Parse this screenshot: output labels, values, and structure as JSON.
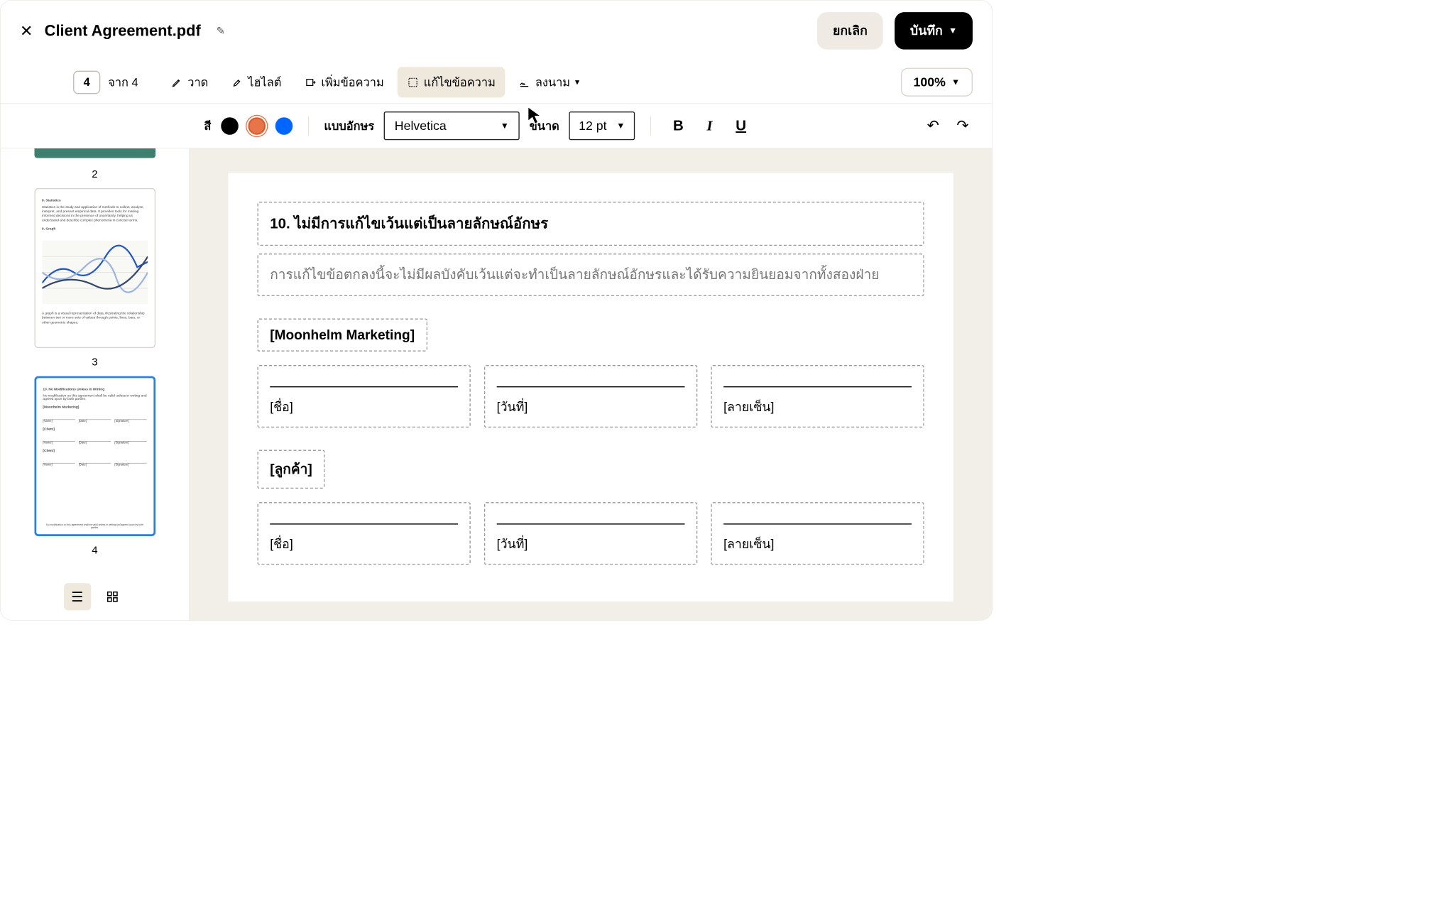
{
  "header": {
    "title": "Client Agreement.pdf",
    "cancel_label": "ยกเลิก",
    "save_label": "บันทึก"
  },
  "toolbar": {
    "page_current": "4",
    "page_total_prefix": "จาก",
    "page_total": "4",
    "draw_label": "วาด",
    "highlight_label": "ไฮไลต์",
    "addtext_label": "เพิ่มข้อความ",
    "edittext_label": "แก้ไขข้อความ",
    "sign_label": "ลงนาม",
    "zoom_label": "100%"
  },
  "subtoolbar": {
    "color_label": "สี",
    "font_label": "แบบอักษร",
    "font_value": "Helvetica",
    "size_label": "ขนาด",
    "size_value": "12 pt"
  },
  "sidebar": {
    "page2_num": "2",
    "page3_num": "3",
    "page4_num": "4",
    "thumb3": {
      "h1": "8. Statistics",
      "p1": "Statistics is the study and application of methods to collect, analyze, interpret, and present empirical data. It provides tools for making informed decisions in the presence of uncertainty, helping us understand and describe complex phenomena in concise terms.",
      "h2": "9. Graph",
      "p2": "A graph is a visual representation of data, illustrating the relationship between two or more sets of values through points, lines, bars, or other geometric shapes."
    },
    "thumb4": {
      "h1": "10. No Modifications Unless In Writing",
      "p1": "No modification on this agreement shall be valid unless in writing and agreed upon by both parties.",
      "company": "[Moonhelm Marketing]",
      "name": "[Name]",
      "date": "[Date]",
      "signature": "[Signature]",
      "client": "[Client]"
    }
  },
  "document": {
    "section_heading": "10. ไม่มีการแก้ไขเว้นแต่เป็นลายลักษณ์อักษร",
    "section_body": "การแก้ไขข้อตกลงนี้จะไม่มีผลบังคับเว้นแต่จะทำเป็นลายลักษณ์อักษรและได้รับความยินยอมจากทั้งสองฝ่าย",
    "party1": "[Moonhelm Marketing]",
    "party2": "[ลูกค้า]",
    "field_name": "[ชื่อ]",
    "field_date": "[วันที่]",
    "field_signature": "[ลายเซ็น]"
  }
}
